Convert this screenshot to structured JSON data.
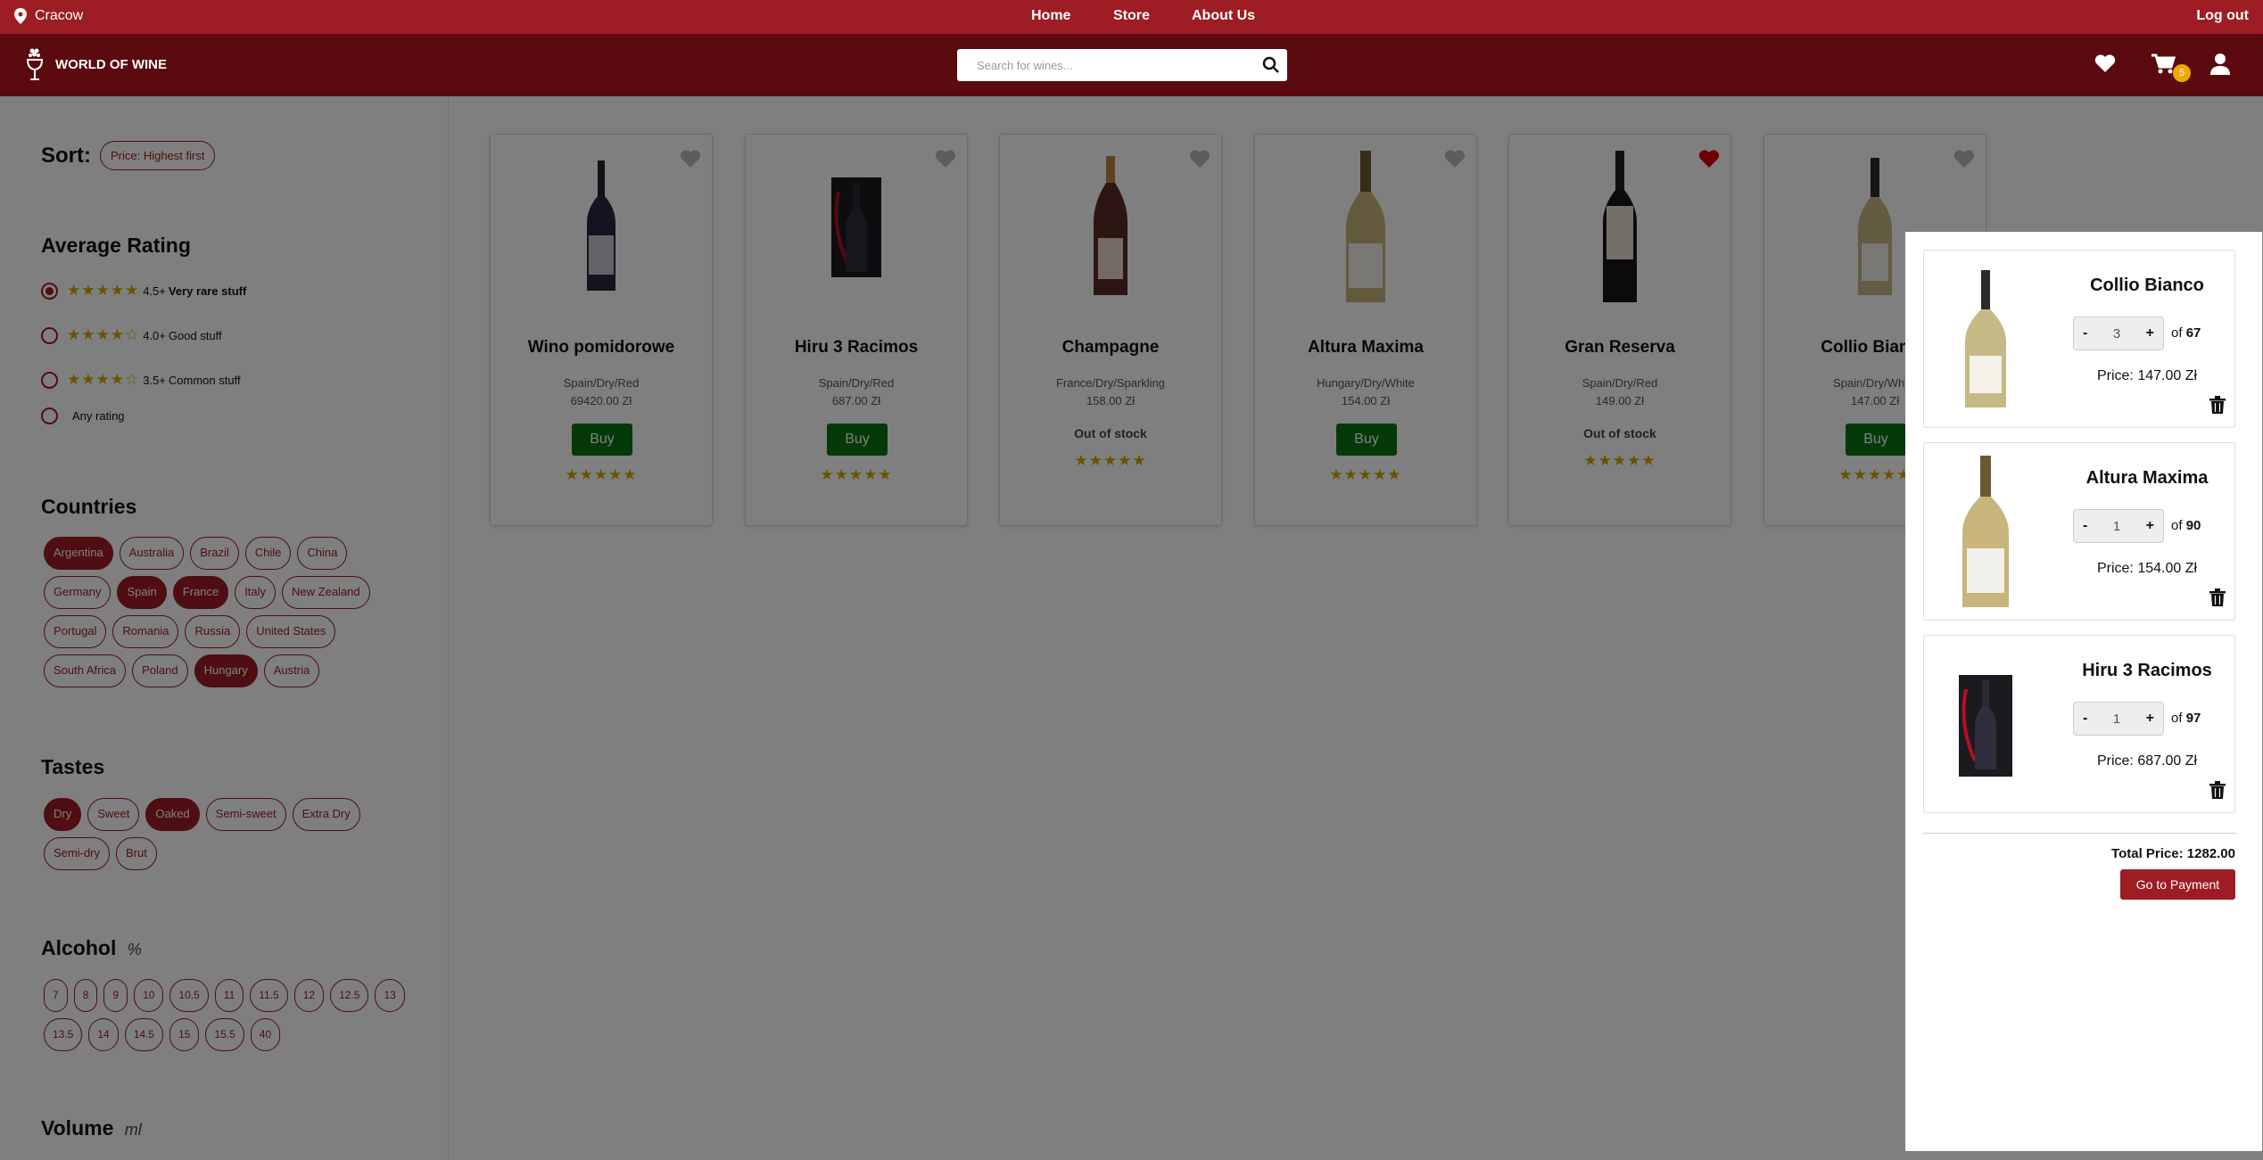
{
  "topbar": {
    "location": "Cracow",
    "nav": {
      "home": "Home",
      "store": "Store",
      "about": "About Us"
    },
    "logout": "Log out"
  },
  "header": {
    "brand": "WORLD OF WINE",
    "search_placeholder": "Search for wines...",
    "cart_count": "5"
  },
  "filters": {
    "sort_label": "Sort:",
    "sort_value": "Price: Highest first",
    "rating_title": "Average Rating",
    "ratings": [
      {
        "stars": "★★★★★",
        "value": "4.5+",
        "text": "Very rare stuff",
        "selected": true
      },
      {
        "stars": "★★★★☆",
        "value": "4.0+",
        "text": "Good stuff",
        "selected": false
      },
      {
        "stars": "★★★★☆",
        "value": "3.5+",
        "text": "Common stuff",
        "selected": false
      },
      {
        "stars": "",
        "value": "",
        "text": "Any rating",
        "selected": false
      }
    ],
    "countries_title": "Countries",
    "countries": [
      "Argentina",
      "Australia",
      "Brazil",
      "Chile",
      "China",
      "Germany",
      "Spain",
      "France",
      "Italy",
      "New Zealand",
      "Portugal",
      "Romania",
      "Russia",
      "United States",
      "South Africa",
      "Poland",
      "Hungary",
      "Austria"
    ],
    "tastes_title": "Tastes",
    "tastes": [
      "Dry",
      "Sweet",
      "Oaked",
      "Semi-sweet",
      "Extra Dry",
      "Semi-dry",
      "Brut"
    ],
    "alcohol_title": "Alcohol",
    "alcohol_unit": "%",
    "alcohol": [
      "7",
      "8",
      "9",
      "10",
      "10.5",
      "11",
      "11.5",
      "12",
      "12.5",
      "13",
      "13.5",
      "14",
      "14.5",
      "15",
      "15.5",
      "40"
    ],
    "volume_title": "Volume",
    "volume_unit": "ml"
  },
  "products": [
    {
      "name": "Wino pomidorowe",
      "meta": "Spain/Dry/Red",
      "price": "69420.00 Zł",
      "action": "Buy",
      "rating": "★★★★★",
      "favorite": false
    },
    {
      "name": "Hiru 3 Racimos",
      "meta": "Spain/Dry/Red",
      "price": "687.00 Zł",
      "action": "Buy",
      "rating": "★★★★★",
      "favorite": false
    },
    {
      "name": "Champagne",
      "meta": "France/Dry/Sparkling",
      "price": "158.00 Zł",
      "action": "Out of stock",
      "rating": "★★★★★",
      "favorite": false
    },
    {
      "name": "Altura Maxima",
      "meta": "Hungary/Dry/White",
      "price": "154.00 Zł",
      "action": "Buy",
      "rating": "★★★★★",
      "favorite": false
    },
    {
      "name": "Gran Reserva",
      "meta": "Spain/Dry/Red",
      "price": "149.00 Zł",
      "action": "Out of stock",
      "rating": "★★★★★",
      "favorite": true
    },
    {
      "name": "Collio Bianco",
      "meta": "Spain/Dry/White",
      "price": "147.00 Zł",
      "action": "Buy",
      "rating": "★★★★★",
      "favorite": false
    }
  ],
  "cart": {
    "items": [
      {
        "name": "Collio Bianco",
        "qty": "3",
        "of_label": "of",
        "stock": "67",
        "price": "Price: 147.00 Zł"
      },
      {
        "name": "Altura Maxima",
        "qty": "1",
        "of_label": "of",
        "stock": "90",
        "price": "Price: 154.00 Zł"
      },
      {
        "name": "Hiru 3 Racimos",
        "qty": "1",
        "of_label": "of",
        "stock": "97",
        "price": "Price: 687.00 Zł"
      }
    ],
    "total": "Total Price: 1282.00",
    "pay_label": "Go to Payment",
    "minus": "-",
    "plus": "+"
  },
  "colors": {
    "topbar": "#9e1c23",
    "header": "#5b0a0f",
    "buy": "#0a7212",
    "star": "#d9a400",
    "badge": "#f0a800"
  }
}
